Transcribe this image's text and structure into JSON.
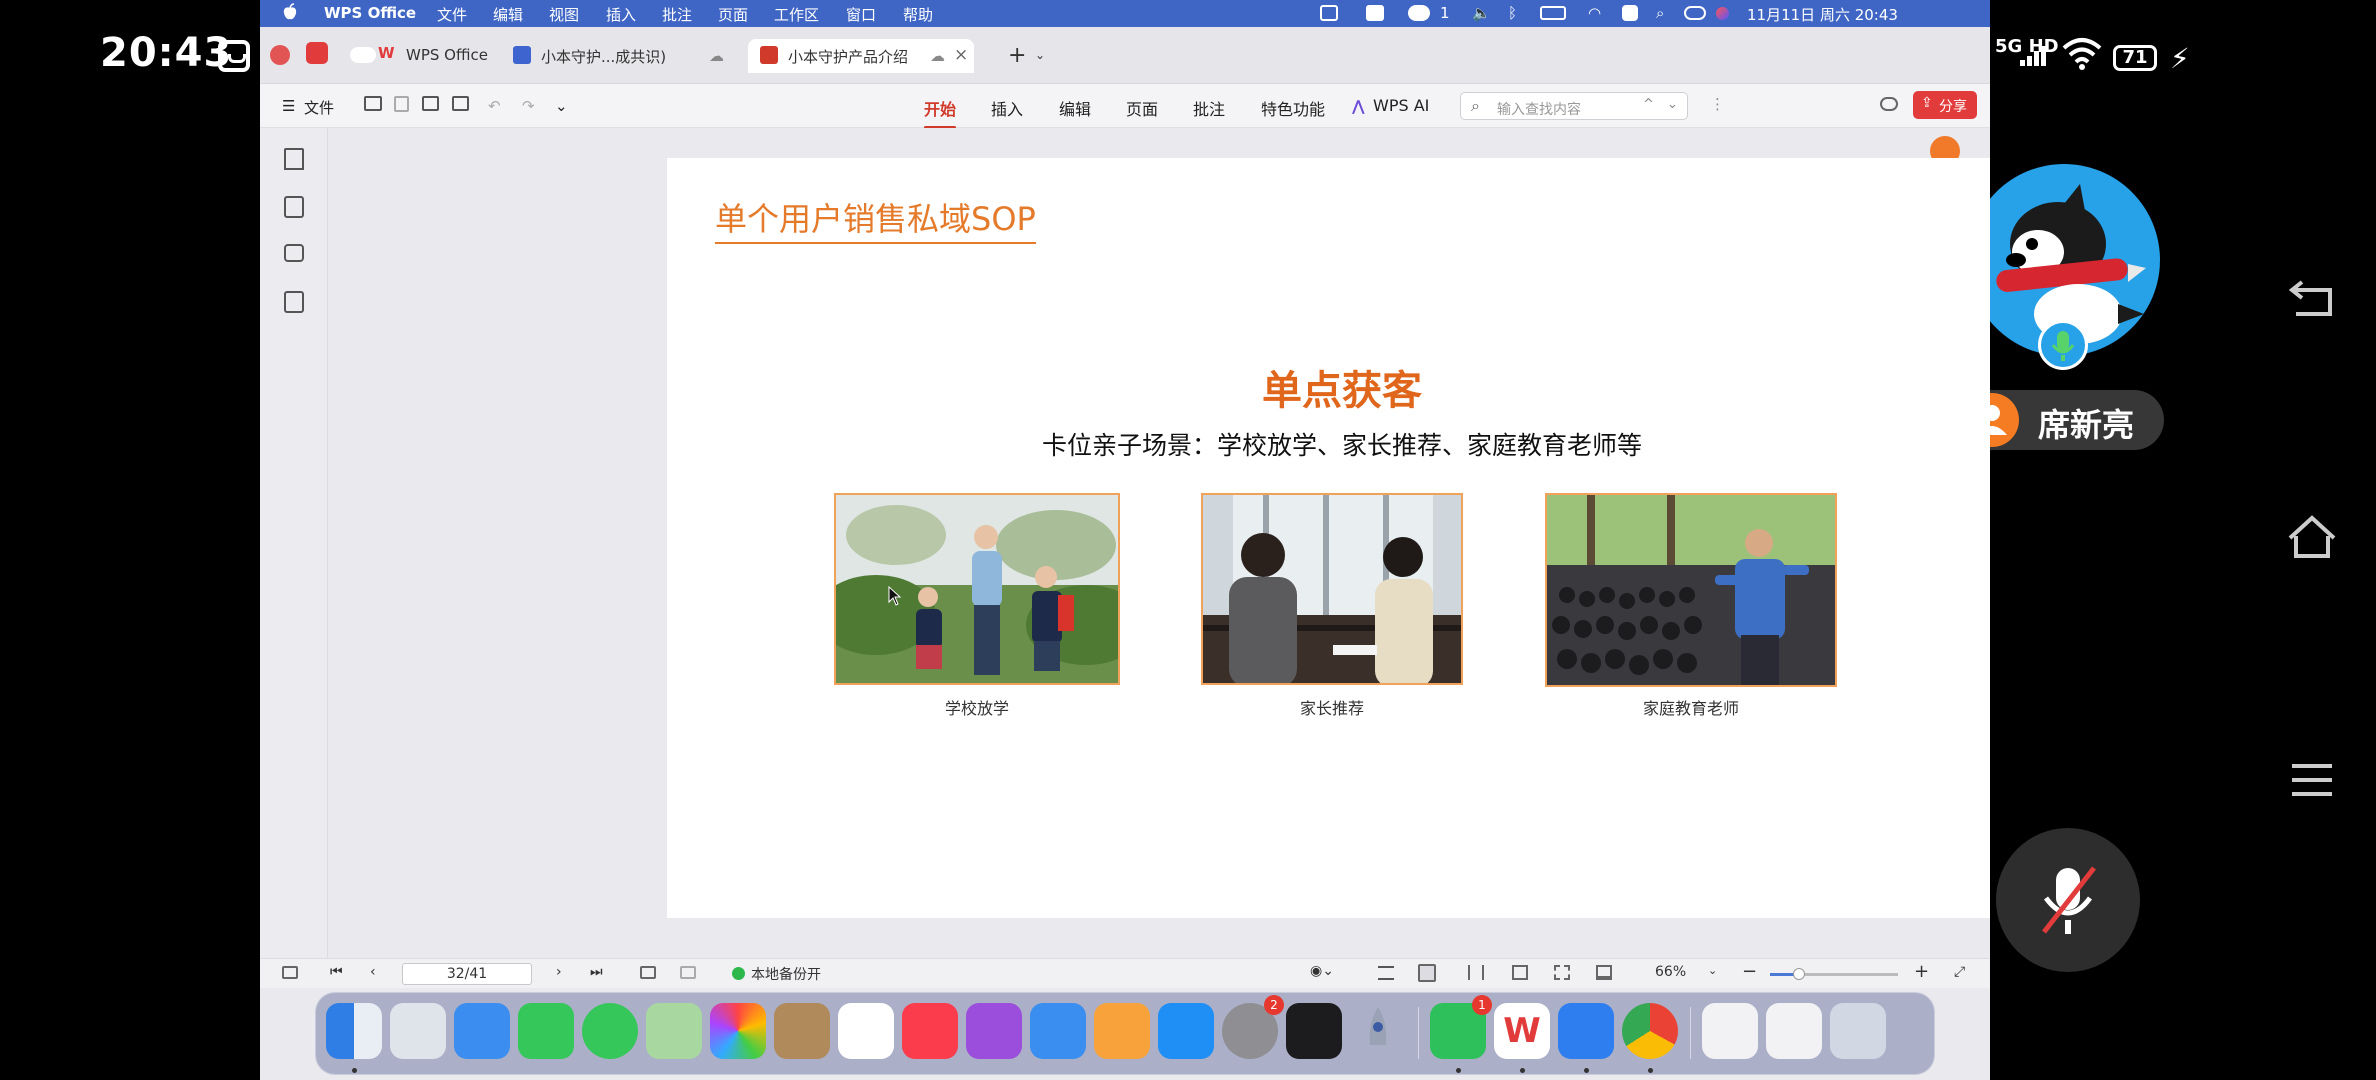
{
  "phone": {
    "time": "20:43",
    "network": "5G HD",
    "battery": "71"
  },
  "call": {
    "participant_name": "席新亮"
  },
  "mac_menubar": {
    "app_name": "WPS Office",
    "menus": [
      "文件",
      "编辑",
      "视图",
      "插入",
      "批注",
      "页面",
      "工作区",
      "窗口",
      "帮助"
    ],
    "notification_count": "1",
    "datetime": "11月11日 周六  20:43"
  },
  "tabs": [
    {
      "label": "WPS Office",
      "color": "#e23b3b"
    },
    {
      "label": "小本守护...成共识)",
      "color": "#3e64d0"
    },
    {
      "label": "小本守护产品介绍",
      "color": "#d03a2b"
    }
  ],
  "toolbar": {
    "file_label": "文件",
    "ribbon_tabs": [
      "开始",
      "插入",
      "编辑",
      "页面",
      "批注",
      "特色功能"
    ],
    "ai_label": "WPS AI",
    "search_placeholder": "输入查找内容",
    "share_label": "分享"
  },
  "slide": {
    "title": "单个用户销售私域SOP",
    "heading": "单点获客",
    "subheading": "卡位亲子场景：学校放学、家长推荐、家庭教育老师等",
    "photos": [
      {
        "caption": "学校放学"
      },
      {
        "caption": "家长推荐"
      },
      {
        "caption": "家庭教育老师"
      }
    ]
  },
  "statusbar": {
    "page": "32/41",
    "backup": "本地备份开",
    "zoom": "66%",
    "zoom_fraction": 0.23
  },
  "dock": {
    "system_settings_badge": "2",
    "wechat_badge": "1"
  },
  "colors": {
    "accent_red": "#d03a2b",
    "slide_orange": "#e47a2a",
    "menubar_blue": "#3f66c5"
  }
}
